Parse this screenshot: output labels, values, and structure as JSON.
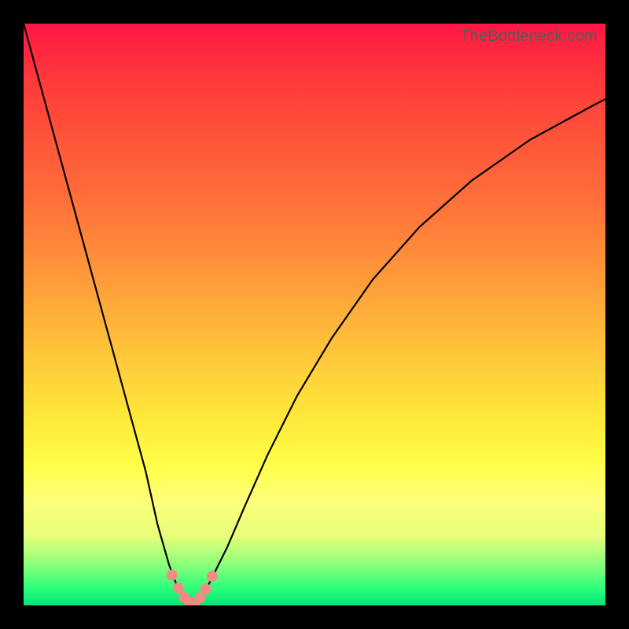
{
  "watermark": "TheBottleneck.com",
  "chart_data": {
    "type": "line",
    "title": "",
    "xlabel": "",
    "ylabel": "",
    "xlim": [
      0,
      100
    ],
    "ylim": [
      0,
      100
    ],
    "grid": false,
    "legend": false,
    "note": "Values estimated from pixels; chart has no tick labels. y≈0 is optimal (green), y≈100 is worst (red). Curve attains its minimum near x≈29.",
    "series": [
      {
        "name": "bottleneck-curve",
        "color": "#000000",
        "x": [
          0,
          3,
          6,
          9,
          12,
          15,
          18,
          21,
          23,
          25,
          26.5,
          28,
          29,
          30,
          31.5,
          33,
          35,
          38,
          42,
          47,
          53,
          60,
          68,
          77,
          87,
          98,
          100
        ],
        "y": [
          100,
          89,
          78,
          67,
          56,
          45,
          34,
          23,
          14,
          7,
          3,
          1,
          0,
          1,
          3,
          6,
          10,
          17,
          26,
          36,
          46,
          56,
          65,
          73,
          80,
          86,
          87
        ]
      },
      {
        "name": "highlight-dots",
        "color": "#f28b82",
        "marker": "circle",
        "x": [
          25.5,
          26.6,
          27.6,
          28.5,
          29.4,
          30.3,
          31.3,
          32.4
        ],
        "y": [
          5.2,
          3.0,
          1.4,
          0.5,
          0.5,
          1.3,
          2.8,
          5.0
        ]
      }
    ],
    "background_gradient": {
      "direction": "vertical",
      "stops": [
        {
          "pos": 0.0,
          "color": "#ff1744"
        },
        {
          "pos": 0.5,
          "color": "#ffca3a"
        },
        {
          "pos": 0.78,
          "color": "#ffff4a"
        },
        {
          "pos": 1.0,
          "color": "#00e676"
        }
      ]
    }
  }
}
